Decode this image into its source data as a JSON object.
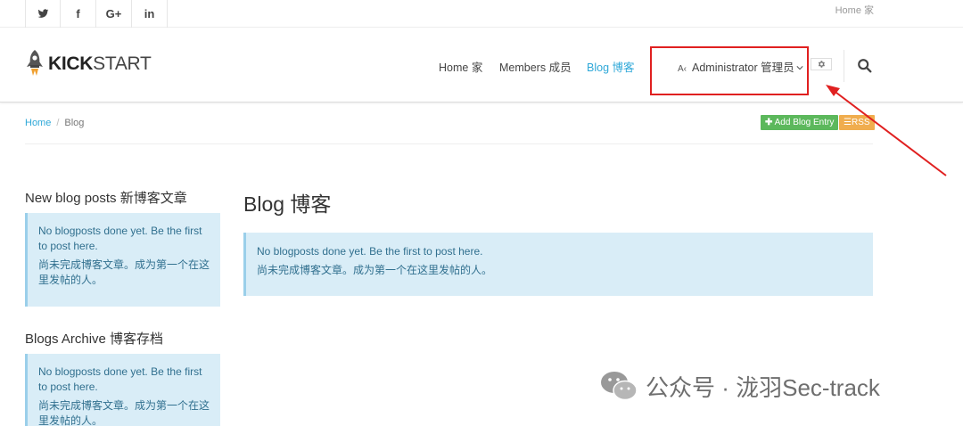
{
  "topbar": {
    "social": [
      "twitter-icon",
      "facebook-icon",
      "google-plus-icon",
      "linkedin-icon"
    ],
    "social_labels": {
      "facebook": "f",
      "google": "G+",
      "linkedin": "in"
    },
    "home_link": "Home 家"
  },
  "header": {
    "logo_bold": "KICK",
    "logo_rest": "START",
    "nav": [
      {
        "label": "Home 家",
        "active": false
      },
      {
        "label": "Members 成员",
        "active": false
      },
      {
        "label": "Blog 博客",
        "active": true
      }
    ],
    "admin": {
      "badge": "A‹",
      "label": "Administrator 管理员"
    }
  },
  "breadcrumb": {
    "home": "Home",
    "separator": "/",
    "current": "Blog"
  },
  "actions": {
    "add": "Add Blog Entry",
    "rss": "RSS"
  },
  "sidebar": {
    "new_posts_title": "New blog posts 新博客文章",
    "new_posts_msg_en": "No blogposts done yet. Be the first to post here.",
    "new_posts_msg_zh": "尚未完成博客文章。成为第一个在这里发帖的人。",
    "archive_title": "Blogs Archive 博客存档",
    "archive_msg_en": "No blogposts done yet. Be the first to post here.",
    "archive_msg_zh": "尚未完成博客文章。成为第一个在这里发帖的人。"
  },
  "main": {
    "title": "Blog 博客",
    "msg_en": "No blogposts done yet. Be the first to post here.",
    "msg_zh": "尚未完成博客文章。成为第一个在这里发帖的人。"
  },
  "watermark": "公众号 · 泷羽Sec-track",
  "colors": {
    "accent": "#2fa8d8",
    "alert_bg": "#d9edf7",
    "alert_text": "#31708f",
    "add_btn": "#5cb85c",
    "rss_btn": "#f0ad4e",
    "highlight": "#e02020"
  }
}
